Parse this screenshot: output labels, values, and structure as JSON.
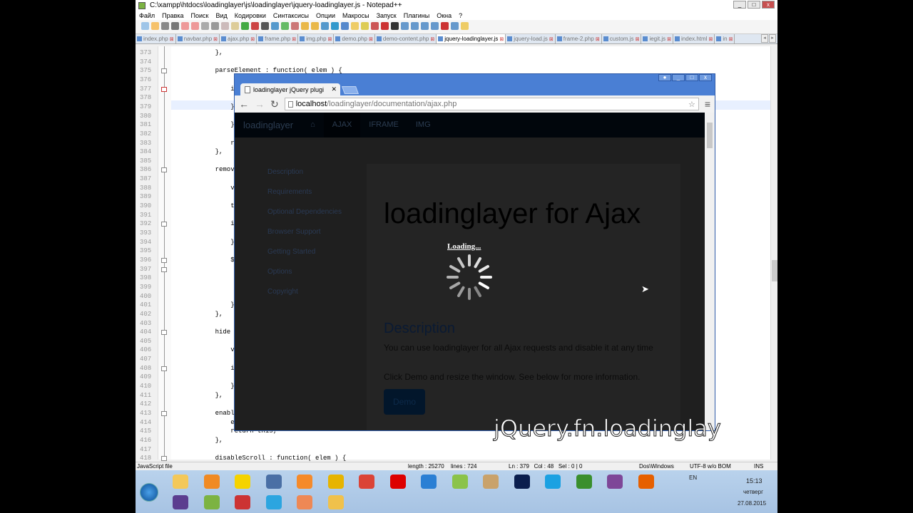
{
  "npp": {
    "title": "C:\\xampp\\htdocs\\loadinglayer\\js\\loadinglayer\\jquery-loadinglayer.js - Notepad++",
    "menu": [
      "Файл",
      "Правка",
      "Поиск",
      "Вид",
      "Кодировки",
      "Синтаксисы",
      "Опции",
      "Макросы",
      "Запуск",
      "Плагины",
      "Окна",
      "?"
    ],
    "tabs": [
      {
        "label": "index.php"
      },
      {
        "label": "navbar.php"
      },
      {
        "label": "ajax.php"
      },
      {
        "label": "frame.php"
      },
      {
        "label": "img.php"
      },
      {
        "label": "demo.php"
      },
      {
        "label": "demo-content.php"
      },
      {
        "label": "jquery-loadinglayer.js",
        "active": true
      },
      {
        "label": "jquery-load.js"
      },
      {
        "label": "frame-2.php"
      },
      {
        "label": "custom.js"
      },
      {
        "label": "iegit.js"
      },
      {
        "label": "index.html"
      },
      {
        "label": "in"
      }
    ],
    "lines": [
      {
        "n": "373",
        "t": "    },"
      },
      {
        "n": "374",
        "t": ""
      },
      {
        "n": "375",
        "t": "    parseElement : function( elem ) {",
        "f": 1
      },
      {
        "n": "376",
        "t": ""
      },
      {
        "n": "377",
        "t": "        if (",
        "f": 1
      },
      {
        "n": "378",
        "t": ""
      },
      {
        "n": "379",
        "t": "        } el"
      },
      {
        "n": "380",
        "t": ""
      },
      {
        "n": "381",
        "t": "        }"
      },
      {
        "n": "382",
        "t": ""
      },
      {
        "n": "383",
        "t": "        retu"
      },
      {
        "n": "384",
        "t": "    },"
      },
      {
        "n": "385",
        "t": ""
      },
      {
        "n": "386",
        "t": "    remove :",
        "f": 1
      },
      {
        "n": "387",
        "t": ""
      },
      {
        "n": "388",
        "t": "        var"
      },
      {
        "n": "389",
        "t": ""
      },
      {
        "n": "390",
        "t": "        this"
      },
      {
        "n": "391",
        "t": ""
      },
      {
        "n": "392",
        "t": "        if (",
        "f": 1
      },
      {
        "n": "393",
        "t": ""
      },
      {
        "n": "394",
        "t": "        }"
      },
      {
        "n": "395",
        "t": ""
      },
      {
        "n": "396",
        "t": "        $.ea",
        "f": 1
      },
      {
        "n": "397",
        "t": "",
        "f": 1
      },
      {
        "n": "398",
        "t": ""
      },
      {
        "n": "399",
        "t": ""
      },
      {
        "n": "400",
        "t": ""
      },
      {
        "n": "401",
        "t": "        });"
      },
      {
        "n": "402",
        "t": "    },"
      },
      {
        "n": "403",
        "t": ""
      },
      {
        "n": "404",
        "t": "    hide : f",
        "f": 1
      },
      {
        "n": "405",
        "t": ""
      },
      {
        "n": "406",
        "t": "        var"
      },
      {
        "n": "407",
        "t": ""
      },
      {
        "n": "408",
        "t": "        if (",
        "f": 1
      },
      {
        "n": "409",
        "t": ""
      },
      {
        "n": "410",
        "t": "        }"
      },
      {
        "n": "411",
        "t": "    },"
      },
      {
        "n": "412",
        "t": ""
      },
      {
        "n": "413",
        "t": "    enableSc",
        "f": 1
      },
      {
        "n": "414",
        "t": "        elem"
      },
      {
        "n": "415",
        "t": "        return this;"
      },
      {
        "n": "416",
        "t": "    },"
      },
      {
        "n": "417",
        "t": ""
      },
      {
        "n": "418",
        "t": "    disableScroll : function( elem ) {",
        "f": 1
      }
    ],
    "status": {
      "type": "JavaScript file",
      "length": "length : 25270",
      "lines": "lines : 724",
      "pos": "Ln : 379   Col : 48   Sel : 0 | 0",
      "eol": "Dos\\Windows",
      "enc": "UTF-8 w/o BOM",
      "mode": "INS"
    }
  },
  "browser": {
    "tab_title": "loadinglayer jQuery plugi",
    "url_host": "localhost",
    "url_path": "/loadinglayer/documentation/ajax.php",
    "nav": {
      "brand": "loadinglayer",
      "home": "⌂",
      "items": [
        "AJAX",
        "IFRAME",
        "IMG"
      ]
    },
    "sidebar": [
      "Description",
      "Requirements",
      "Optional Dependencies",
      "Browser Support",
      "Getting Started",
      "Options",
      "Copyright"
    ],
    "heading": "loadinglayer for Ajax",
    "section": "Description",
    "p1": "You can use loadinglayer for all Ajax requests and disable it at any time",
    "p2": "Click Demo and resize the window. See below for more information.",
    "demo_button": "Demo",
    "loading": "Loading..."
  },
  "watermark": "jQuery.fn.loadinglay",
  "tray": {
    "lang": "EN",
    "time": "15:13",
    "day": "четверг",
    "date": "27.08.2015"
  }
}
